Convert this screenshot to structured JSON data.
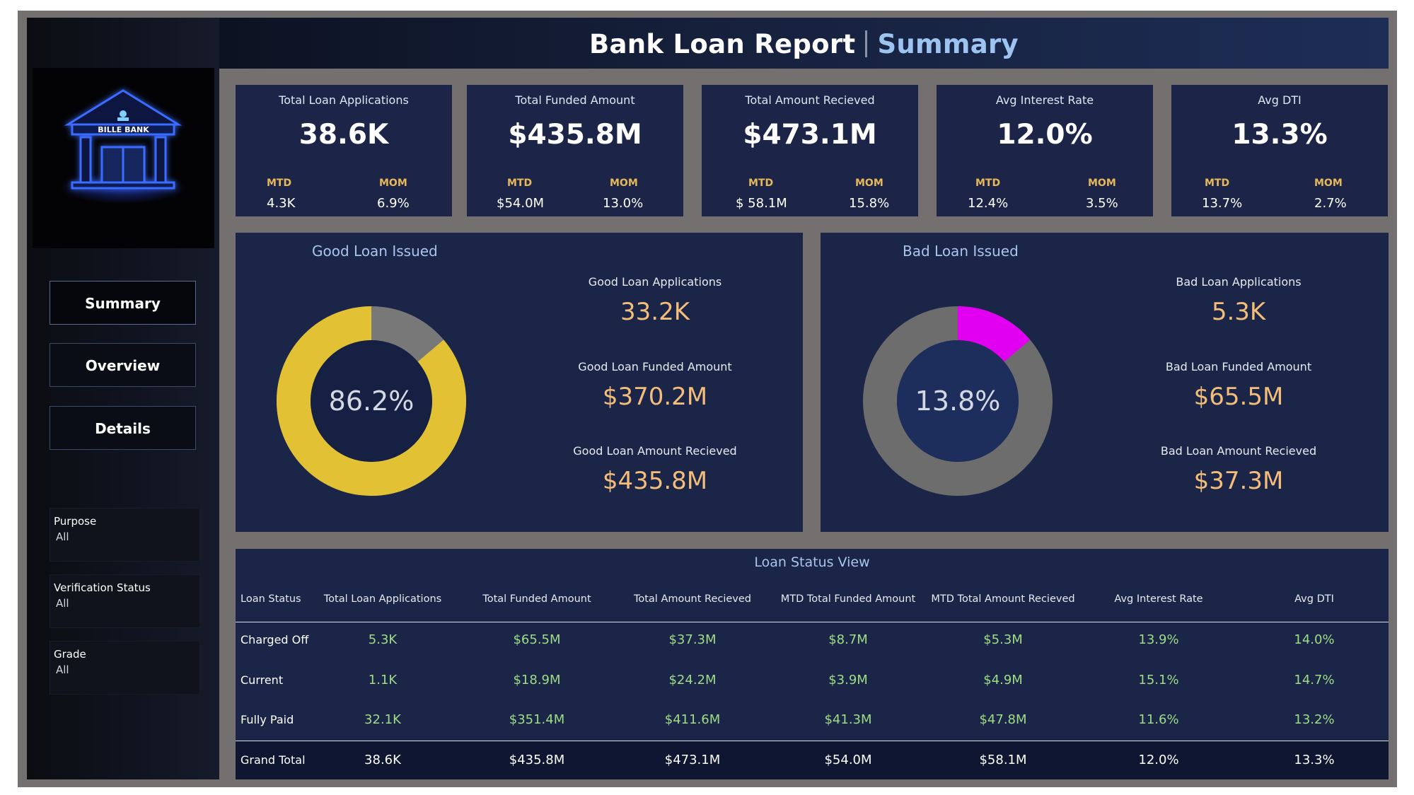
{
  "header": {
    "title": "Bank Loan Report",
    "subtitle": "Summary"
  },
  "logo": {
    "text": "BILLE BANK"
  },
  "nav": [
    "Summary",
    "Overview",
    "Details"
  ],
  "filters": [
    {
      "label": "Purpose",
      "value": "All"
    },
    {
      "label": "Verification Status",
      "value": "All"
    },
    {
      "label": "Grade",
      "value": "All"
    }
  ],
  "kpis": [
    {
      "title": "Total Loan Applications",
      "value": "38.6K",
      "mtd_label": "MTD",
      "mtd": "4.3K",
      "mom_label": "MOM",
      "mom": "6.9%"
    },
    {
      "title": "Total Funded Amount",
      "value": "$435.8M",
      "mtd_label": "MTD",
      "mtd": "$54.0M",
      "mom_label": "MOM",
      "mom": "13.0%"
    },
    {
      "title": "Total Amount Recieved",
      "value": "$473.1M",
      "mtd_label": "MTD",
      "mtd": "$ 58.1M",
      "mom_label": "MOM",
      "mom": "15.8%"
    },
    {
      "title": "Avg Interest Rate",
      "value": "12.0%",
      "mtd_label": "MTD",
      "mtd": "12.4%",
      "mom_label": "MOM",
      "mom": "3.5%"
    },
    {
      "title": "Avg DTI",
      "value": "13.3%",
      "mtd_label": "MTD",
      "mtd": "13.7%",
      "mom_label": "MOM",
      "mom": "2.7%"
    }
  ],
  "good_loan": {
    "title": "Good Loan Issued",
    "percent_label": "86.2%",
    "percent": 86.2,
    "applications_label": "Good Loan Applications",
    "applications": "33.2K",
    "funded_label": "Good Loan Funded Amount",
    "funded": "$370.2M",
    "received_label": "Good Loan Amount Recieved",
    "received": "$435.8M",
    "colors": {
      "highlight": "#e2c135",
      "rest": "#787878"
    }
  },
  "bad_loan": {
    "title": "Bad Loan Issued",
    "percent_label": "13.8%",
    "percent": 13.8,
    "applications_label": "Bad Loan Applications",
    "applications": "5.3K",
    "funded_label": "Bad Loan Funded Amount",
    "funded": "$65.5M",
    "received_label": "Bad Loan Amount Recieved",
    "received": "$37.3M",
    "colors": {
      "highlight": "#e100f0",
      "rest": "#6d6d6d"
    }
  },
  "loan_status": {
    "title": "Loan Status View",
    "columns": [
      "Loan Status",
      "Total Loan Applications",
      "Total Funded Amount",
      "Total Amount Recieved",
      "MTD Total Funded Amount",
      "MTD Total Amount Recieved",
      "Avg Interest Rate",
      "Avg DTI"
    ],
    "rows": [
      {
        "status": "Charged Off",
        "values": [
          "5.3K",
          "$65.5M",
          "$37.3M",
          "$8.7M",
          "$5.3M",
          "13.9%",
          "14.0%"
        ]
      },
      {
        "status": "Current",
        "values": [
          "1.1K",
          "$18.9M",
          "$24.2M",
          "$3.9M",
          "$4.9M",
          "15.1%",
          "14.7%"
        ]
      },
      {
        "status": "Fully Paid",
        "values": [
          "32.1K",
          "$351.4M",
          "$411.6M",
          "$41.3M",
          "$47.8M",
          "11.6%",
          "13.2%"
        ]
      }
    ],
    "total": {
      "status": "Grand Total",
      "values": [
        "38.6K",
        "$435.8M",
        "$473.1M",
        "$54.0M",
        "$58.1M",
        "12.0%",
        "13.3%"
      ]
    }
  }
}
